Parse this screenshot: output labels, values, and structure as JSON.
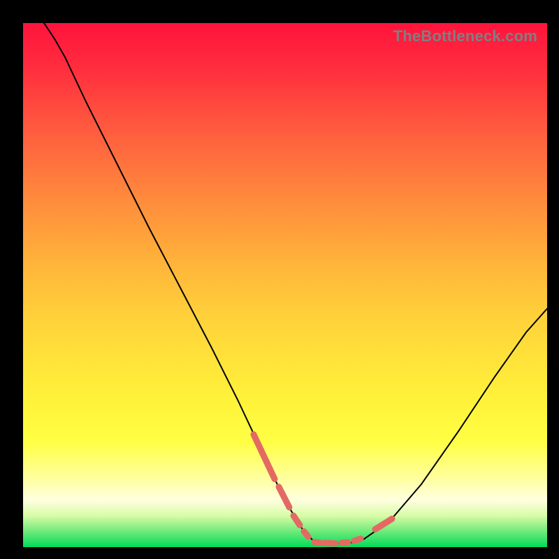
{
  "watermark": "TheBottleneck.com",
  "colors": {
    "page_bg": "#000000",
    "gradient_top": "#ff143c",
    "gradient_bottom": "#00dc5a",
    "line": "#000000",
    "marker": "#e36a62",
    "watermark_text": "#817e82"
  },
  "chart_data": {
    "type": "line",
    "title": "",
    "xlabel": "",
    "ylabel": "",
    "xlim": [
      0,
      100
    ],
    "ylim": [
      0,
      100
    ],
    "grid": false,
    "legend": false,
    "x": [
      4.0,
      6.0,
      8.0,
      12.0,
      18.0,
      24.0,
      30.0,
      36.0,
      41.0,
      45.0,
      48.0,
      51.0,
      53.2,
      55.2,
      57.2,
      59.8,
      62.4,
      65.0,
      70.0,
      76.0,
      83.0,
      90.0,
      96.0,
      100.0
    ],
    "y": [
      100.0,
      97.0,
      93.5,
      85.0,
      73.0,
      61.0,
      49.5,
      38.0,
      28.0,
      19.5,
      13.0,
      7.2,
      3.6,
      1.4,
      0.8,
      0.7,
      0.8,
      1.5,
      5.0,
      12.0,
      22.0,
      32.5,
      41.0,
      45.5
    ],
    "series": [
      {
        "name": "bottleneck-curve",
        "x": [
          4.0,
          6.0,
          8.0,
          12.0,
          18.0,
          24.0,
          30.0,
          36.0,
          41.0,
          45.0,
          48.0,
          51.0,
          53.2,
          55.2,
          57.2,
          59.8,
          62.4,
          65.0,
          70.0,
          76.0,
          83.0,
          90.0,
          96.0,
          100.0
        ],
        "y": [
          100.0,
          97.0,
          93.5,
          85.0,
          73.0,
          61.0,
          49.5,
          38.0,
          28.0,
          19.5,
          13.0,
          7.2,
          3.6,
          1.4,
          0.8,
          0.7,
          0.8,
          1.5,
          5.0,
          12.0,
          22.0,
          32.5,
          41.0,
          45.5
        ]
      }
    ],
    "markers": {
      "name": "highlighted-region",
      "segments": [
        {
          "x": [
            44.0,
            48.0
          ],
          "y": [
            21.5,
            13.0
          ]
        },
        {
          "x": [
            48.8,
            50.8
          ],
          "y": [
            11.5,
            7.6
          ]
        },
        {
          "x": [
            51.6,
            52.8
          ],
          "y": [
            6.0,
            4.2
          ]
        },
        {
          "x": [
            53.6,
            54.4
          ],
          "y": [
            3.0,
            2.0
          ]
        },
        {
          "x": [
            55.6,
            56.8
          ],
          "y": [
            1.0,
            0.8
          ]
        },
        {
          "x": [
            57.6,
            59.6
          ],
          "y": [
            0.8,
            0.7
          ]
        },
        {
          "x": [
            60.8,
            62.0
          ],
          "y": [
            0.8,
            0.9
          ]
        },
        {
          "x": [
            63.2,
            64.4
          ],
          "y": [
            1.2,
            1.6
          ]
        },
        {
          "x": [
            67.2,
            70.4
          ],
          "y": [
            3.4,
            5.4
          ]
        }
      ]
    }
  }
}
